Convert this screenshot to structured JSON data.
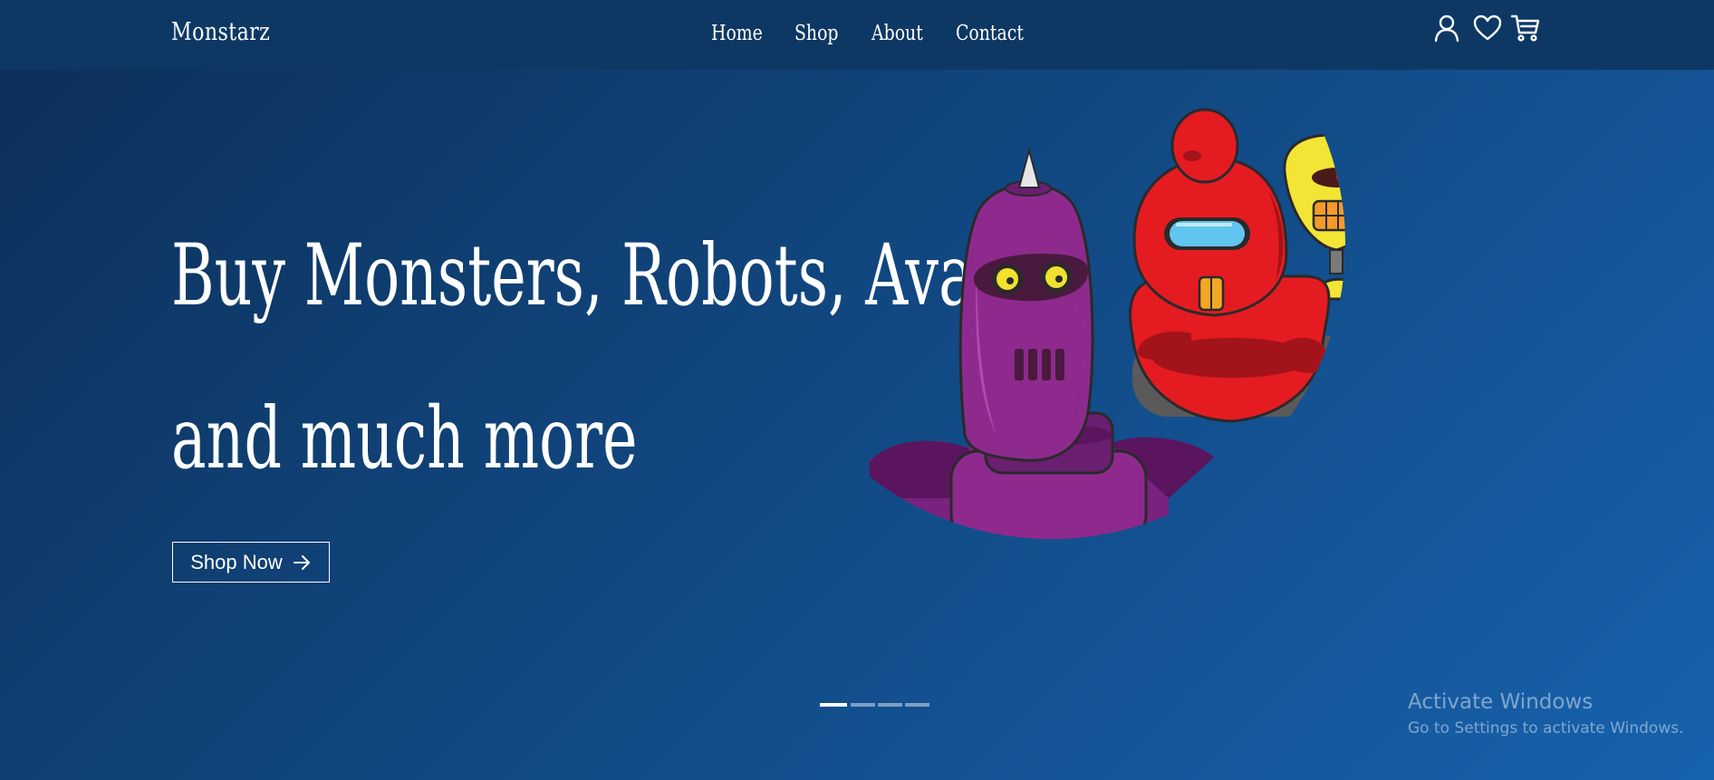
{
  "navbar": {
    "logo": "Monstarz",
    "links": [
      "Home",
      "Shop",
      "About",
      "Contact"
    ],
    "icons": [
      "user-icon",
      "heart-icon",
      "cart-icon"
    ]
  },
  "hero": {
    "title": "Buy Monsters, Robots, Avatars",
    "subtitle": "and much more",
    "cta_label": "Shop Now",
    "cta_icon": "arrow-right-icon",
    "art": [
      "purple-robot",
      "red-robot",
      "yellow-robot"
    ]
  },
  "carousel": {
    "slides": 4,
    "active_index": 0
  },
  "watermark": {
    "title": "Activate Windows",
    "subtitle": "Go to Settings to activate Windows."
  },
  "colors": {
    "navbar": "#0e3864",
    "background_start": "#0c2f57",
    "background_end": "#1762ad",
    "purple_robot": "#8e2a8e",
    "red_robot": "#e51b22",
    "yellow_robot": "#f2e535"
  }
}
